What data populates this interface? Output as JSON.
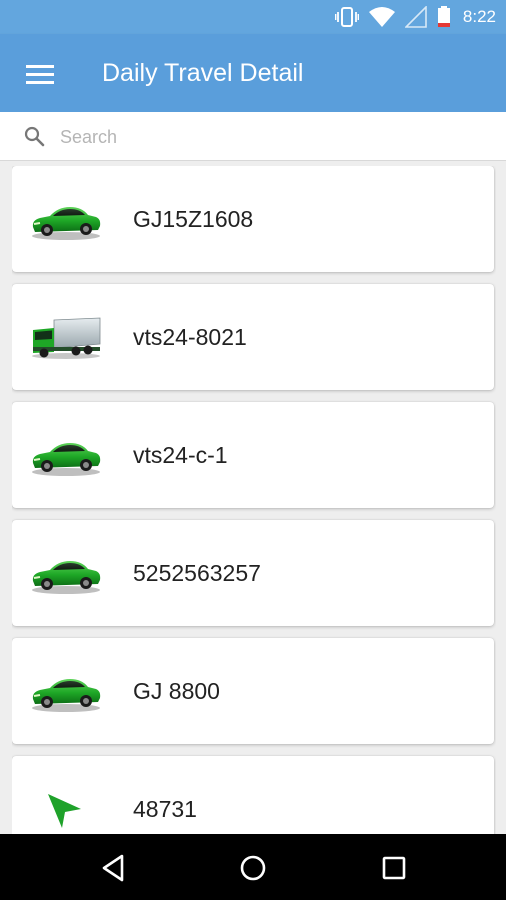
{
  "status_bar": {
    "time": "8:22",
    "icons": [
      "vibrate-icon",
      "wifi-icon",
      "signal-icon",
      "battery-low-icon"
    ]
  },
  "app_bar": {
    "title": "Daily Travel Detail",
    "menu_icon": "hamburger-menu-icon"
  },
  "search": {
    "placeholder": "Search",
    "value": "",
    "icon": "search-icon"
  },
  "vehicles": [
    {
      "name": "GJ15Z1608",
      "icon": "car-icon"
    },
    {
      "name": "vts24-8021",
      "icon": "truck-icon"
    },
    {
      "name": "vts24-c-1",
      "icon": "car-icon"
    },
    {
      "name": "5252563257",
      "icon": "car-icon"
    },
    {
      "name": "GJ 8800",
      "icon": "car-icon"
    },
    {
      "name": "48731",
      "icon": "navigation-arrow-icon"
    }
  ],
  "nav_bar": {
    "buttons": [
      "back-icon",
      "home-icon",
      "recents-icon"
    ]
  },
  "colors": {
    "app_bar": "#5a9edb",
    "status_bar": "#63a6de",
    "vehicle_green": "#1fa22a",
    "battery_low": "#e53935"
  }
}
